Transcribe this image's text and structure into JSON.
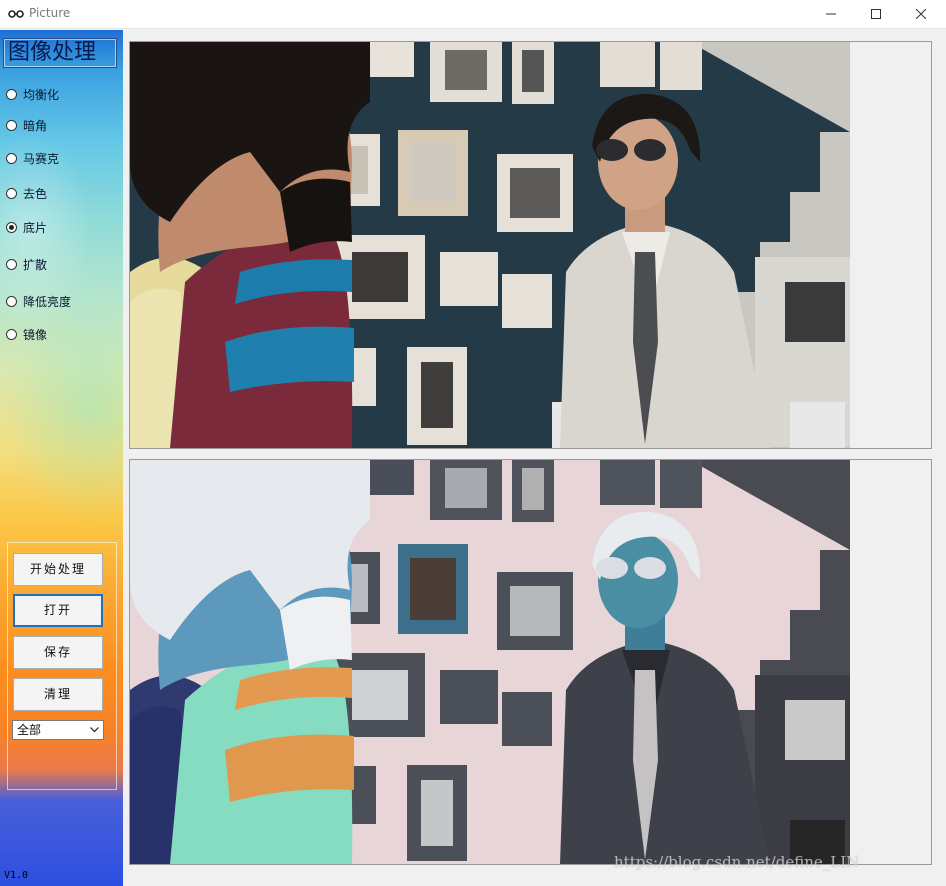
{
  "window": {
    "title": "Picture",
    "icon": "glasses-icon",
    "controls": [
      "minimize-icon",
      "maximize-icon",
      "close-icon"
    ]
  },
  "sidebar": {
    "title": "图像处理",
    "effects": [
      {
        "label": "均衡化",
        "checked": false
      },
      {
        "label": "暗角",
        "checked": false
      },
      {
        "label": "马赛克",
        "checked": false
      },
      {
        "label": "去色",
        "checked": false
      },
      {
        "label": "底片",
        "checked": true
      },
      {
        "label": "扩散",
        "checked": false
      },
      {
        "label": "降低亮度",
        "checked": false
      },
      {
        "label": "镜像",
        "checked": false
      }
    ],
    "buttons": {
      "start": "开始处理",
      "open": "打开",
      "save": "保存",
      "clear": "清理"
    },
    "scope_select": {
      "value": "全部"
    },
    "version": "V1.0"
  },
  "images": {
    "original": "original-photo",
    "processed": "negative-photo"
  },
  "watermark": "https://blog.csdn.net/define_LIN",
  "colors": {
    "sidebar_top": "#1d6fd6",
    "sidebar_bottom": "#2b4fe0",
    "focus_border": "#1d6fbf",
    "photo_wall": "#243844",
    "negative_wall": "#e7d2d5"
  }
}
